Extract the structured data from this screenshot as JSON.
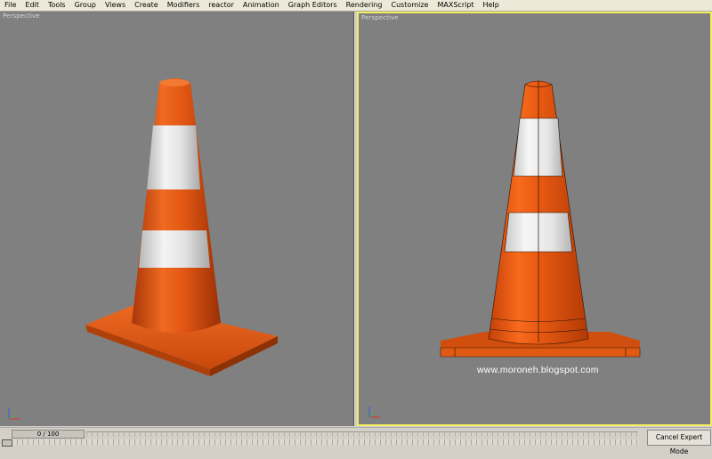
{
  "menu": [
    "File",
    "Edit",
    "Tools",
    "Group",
    "Views",
    "Create",
    "Modifiers",
    "reactor",
    "Animation",
    "Graph Editors",
    "Rendering",
    "Customize",
    "MAXScript",
    "Help"
  ],
  "viewports": {
    "left_label": "Perspective",
    "right_label": "Perspective"
  },
  "watermark": "www.moroneh.blogspot.com",
  "timeline": {
    "frame_display": "0 / 100"
  },
  "expert_mode_button": "Cancel Expert Mode",
  "colors": {
    "cone_orange": "#e85a14",
    "cone_stripe": "#e6e6e6",
    "viewport_bg": "#808080",
    "active_border": "#f2ee60"
  },
  "icons": [
    "axis-tripod-icon",
    "keyframe-icon"
  ]
}
